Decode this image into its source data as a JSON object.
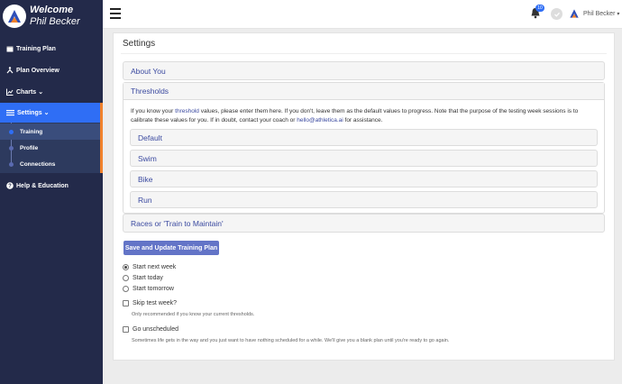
{
  "sidebar": {
    "welcome": "Welcome",
    "user_name": "Phil Becker",
    "items": [
      {
        "label": "Training Plan"
      },
      {
        "label": "Plan Overview"
      },
      {
        "label": "Charts"
      },
      {
        "label": "Settings"
      },
      {
        "label": "Help & Education"
      }
    ],
    "settings_sub": [
      {
        "label": "Training"
      },
      {
        "label": "Profile"
      },
      {
        "label": "Connections"
      }
    ]
  },
  "topbar": {
    "notification_count": "10",
    "user_name": "Phil Becker"
  },
  "main": {
    "title": "Settings",
    "about_you": "About You",
    "thresholds": "Thresholds",
    "thresholds_text_1": "If you know your ",
    "thresholds_link": "threshold",
    "thresholds_text_2": " values, please enter them here. If you don't, leave them as the default values to progress. Note that the purpose of the testing week sessions is to calibrate these values for you. If in doubt, contact your coach or ",
    "email": "hello@athletica.ai",
    "thresholds_text_3": " for assistance.",
    "sub_sections": [
      "Default",
      "Swim",
      "Bike",
      "Run"
    ],
    "races": "Races or 'Train to Maintain'",
    "save_button": "Save and Update Training Plan",
    "start_options": [
      "Start next week",
      "Start today",
      "Start tomorrow"
    ],
    "selected_start": "Start next week",
    "skip_test_label": "Skip test week?",
    "skip_test_help": "Only recommended if you know your current thresholds.",
    "go_unscheduled_label": "Go unscheduled",
    "go_unscheduled_help": "Sometimes life gets in the way and you just want to have nothing scheduled for a while. We'll give you a blank plan until you're ready to go again."
  },
  "colors": {
    "sidebar_bg": "#232a4a",
    "accent_blue": "#2f6ef5",
    "accent_orange": "#f0822d",
    "link": "#3b4aa0",
    "button": "#6374c7"
  }
}
